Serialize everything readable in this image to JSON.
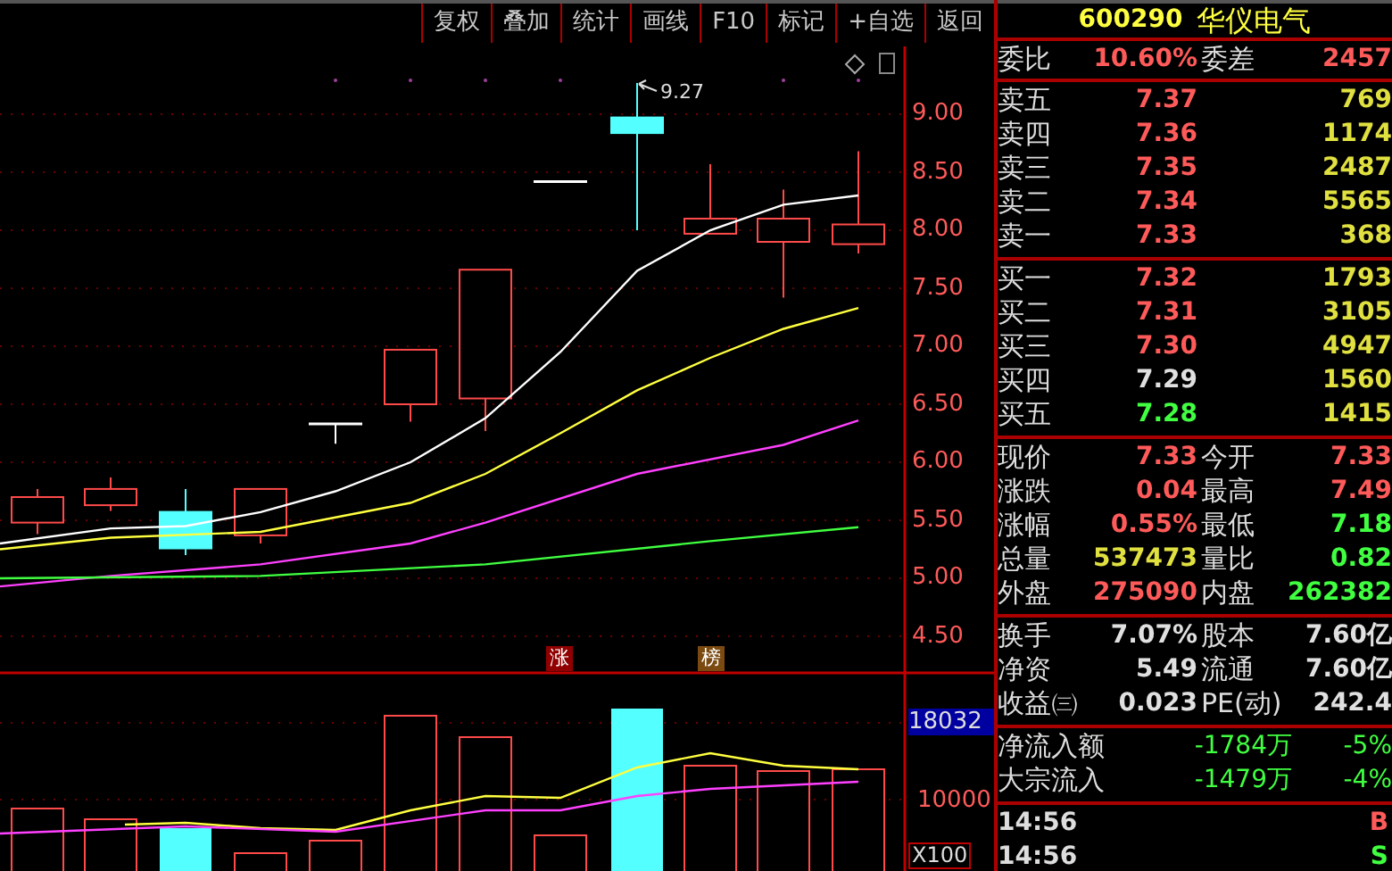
{
  "toolbar": [
    "复权",
    "叠加",
    "统计",
    "画线",
    "F10",
    "标记",
    "+自选",
    "返回"
  ],
  "stock": {
    "code": "600290",
    "name": "华仪电气"
  },
  "chart": {
    "peak_label": "9.27",
    "price_ticks": [
      "9.00",
      "8.50",
      "8.00",
      "7.50",
      "7.00",
      "6.50",
      "6.00",
      "5.50",
      "5.00",
      "4.50"
    ],
    "markers": [
      {
        "text": "涨",
        "color": "#900000"
      },
      {
        "text": "榜",
        "color": "#7a4a10"
      }
    ],
    "volume_ticks": [
      "18032",
      "10000"
    ],
    "volume_unit": "X100"
  },
  "order_ratio": {
    "label": "委比",
    "value": "10.60%",
    "label_2": "委差",
    "value_2": "2457"
  },
  "asks": [
    {
      "label": "卖五",
      "price": "7.37",
      "color": "#ff5a5a",
      "volume": "769"
    },
    {
      "label": "卖四",
      "price": "7.36",
      "color": "#ff5a5a",
      "volume": "1174"
    },
    {
      "label": "卖三",
      "price": "7.35",
      "color": "#ff5a5a",
      "volume": "2487"
    },
    {
      "label": "卖二",
      "price": "7.34",
      "color": "#ff5a5a",
      "volume": "5565"
    },
    {
      "label": "卖一",
      "price": "7.33",
      "color": "#ff5a5a",
      "volume": "368"
    }
  ],
  "bids": [
    {
      "label": "买一",
      "price": "7.32",
      "color": "#ff5a5a",
      "volume": "1793"
    },
    {
      "label": "买二",
      "price": "7.31",
      "color": "#ff5a5a",
      "volume": "3105"
    },
    {
      "label": "买三",
      "price": "7.30",
      "color": "#ff5a5a",
      "volume": "4947"
    },
    {
      "label": "买四",
      "price": "7.29",
      "color": "#e0e0e0",
      "volume": "1560"
    },
    {
      "label": "买五",
      "price": "7.28",
      "color": "#40ff40",
      "volume": "1415"
    }
  ],
  "quote": [
    {
      "label": "现价",
      "value": "7.33",
      "color": "#ff5a5a"
    },
    {
      "label": "今开",
      "value": "7.33",
      "color": "#ff5a5a"
    },
    {
      "label": "涨跌",
      "value": "0.04",
      "color": "#ff5a5a"
    },
    {
      "label": "最高",
      "value": "7.49",
      "color": "#ff5a5a"
    },
    {
      "label": "涨幅",
      "value": "0.55%",
      "color": "#ff5a5a"
    },
    {
      "label": "最低",
      "value": "7.18",
      "color": "#40ff40"
    },
    {
      "label": "总量",
      "value": "537473",
      "color": "#e0e040"
    },
    {
      "label": "量比",
      "value": "0.82",
      "color": "#40ff40"
    },
    {
      "label": "外盘",
      "value": "275090",
      "color": "#ff5a5a"
    },
    {
      "label": "内盘",
      "value": "262382",
      "color": "#40ff40"
    }
  ],
  "fundamentals": [
    {
      "label": "换手",
      "value": "7.07%",
      "label_2": "股本",
      "value_2": "7.60亿"
    },
    {
      "label": "净资",
      "value": "5.49",
      "label_2": "流通",
      "value_2": "7.60亿"
    },
    {
      "label": "收益㈢",
      "value": "0.023",
      "label_2": "PE(动)",
      "value_2": "242.4"
    }
  ],
  "flows": [
    {
      "label": "净流入额",
      "value": "-1784万",
      "share": "-5%"
    },
    {
      "label": "大宗流入",
      "value": "-1479万",
      "share": "-4%"
    }
  ],
  "trades": [
    {
      "time": "14:56",
      "side": "B",
      "color": "#ff5a5a"
    },
    {
      "time": "14:56",
      "side": "S",
      "color": "#40ff40"
    }
  ]
}
